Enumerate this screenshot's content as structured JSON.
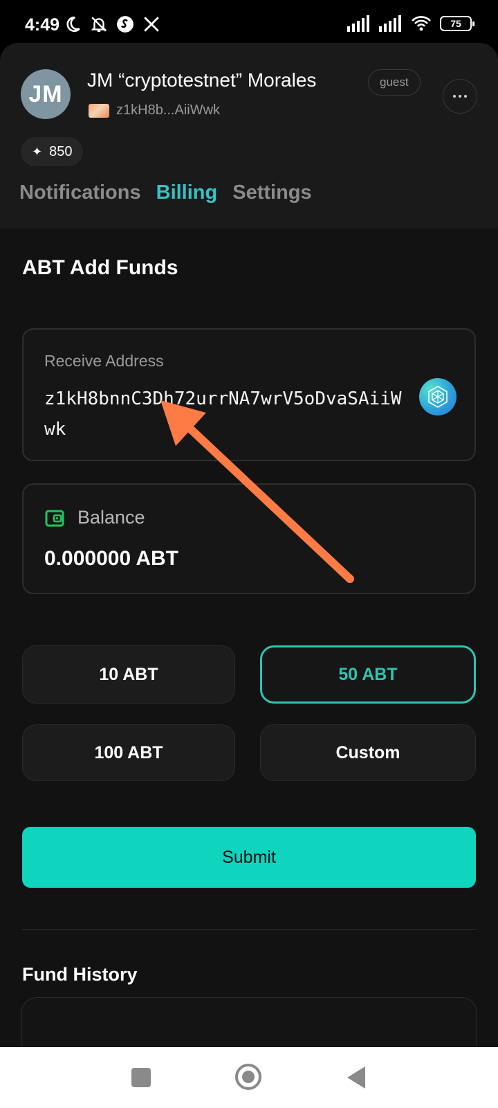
{
  "status_bar": {
    "time": "4:49",
    "battery": "75",
    "left_icons": [
      "moon-icon",
      "bell-off-icon",
      "shazam-icon",
      "x-logo-icon"
    ],
    "right_icons": [
      "signal-icon",
      "signal-icon",
      "wifi-icon",
      "battery-icon"
    ]
  },
  "profile": {
    "avatar_initials": "JM",
    "name": "JM “cryptotestnet” Morales",
    "badge": "guest",
    "wallet_short": "z1kH8b...AiiWwk",
    "points": "850"
  },
  "tabs": [
    {
      "label": "Notifications",
      "active": false
    },
    {
      "label": "Billing",
      "active": true
    },
    {
      "label": "Settings",
      "active": false
    }
  ],
  "add_funds": {
    "title": "ABT Add Funds",
    "receive_label": "Receive Address",
    "receive_address": "z1kH8bnnC3Dh72urrNA7wrV5oDvaSAiiWwk",
    "balance_label": "Balance",
    "balance_value": "0.000000 ABT"
  },
  "amount_options": [
    {
      "label": "10 ABT",
      "selected": false
    },
    {
      "label": "50 ABT",
      "selected": true
    },
    {
      "label": "100 ABT",
      "selected": false
    },
    {
      "label": "Custom",
      "selected": false
    }
  ],
  "submit_label": "Submit",
  "fund_history": {
    "title": "Fund History"
  },
  "colors": {
    "accent": "#36c2c6",
    "submit_bg": "#0fd4be",
    "selected_border": "#2fc4b2",
    "annotation_arrow": "#ff7b45",
    "wallet_icon": "#22c55e"
  },
  "nav_bar": [
    "recents-square-icon",
    "home-circle-icon",
    "back-triangle-icon"
  ]
}
